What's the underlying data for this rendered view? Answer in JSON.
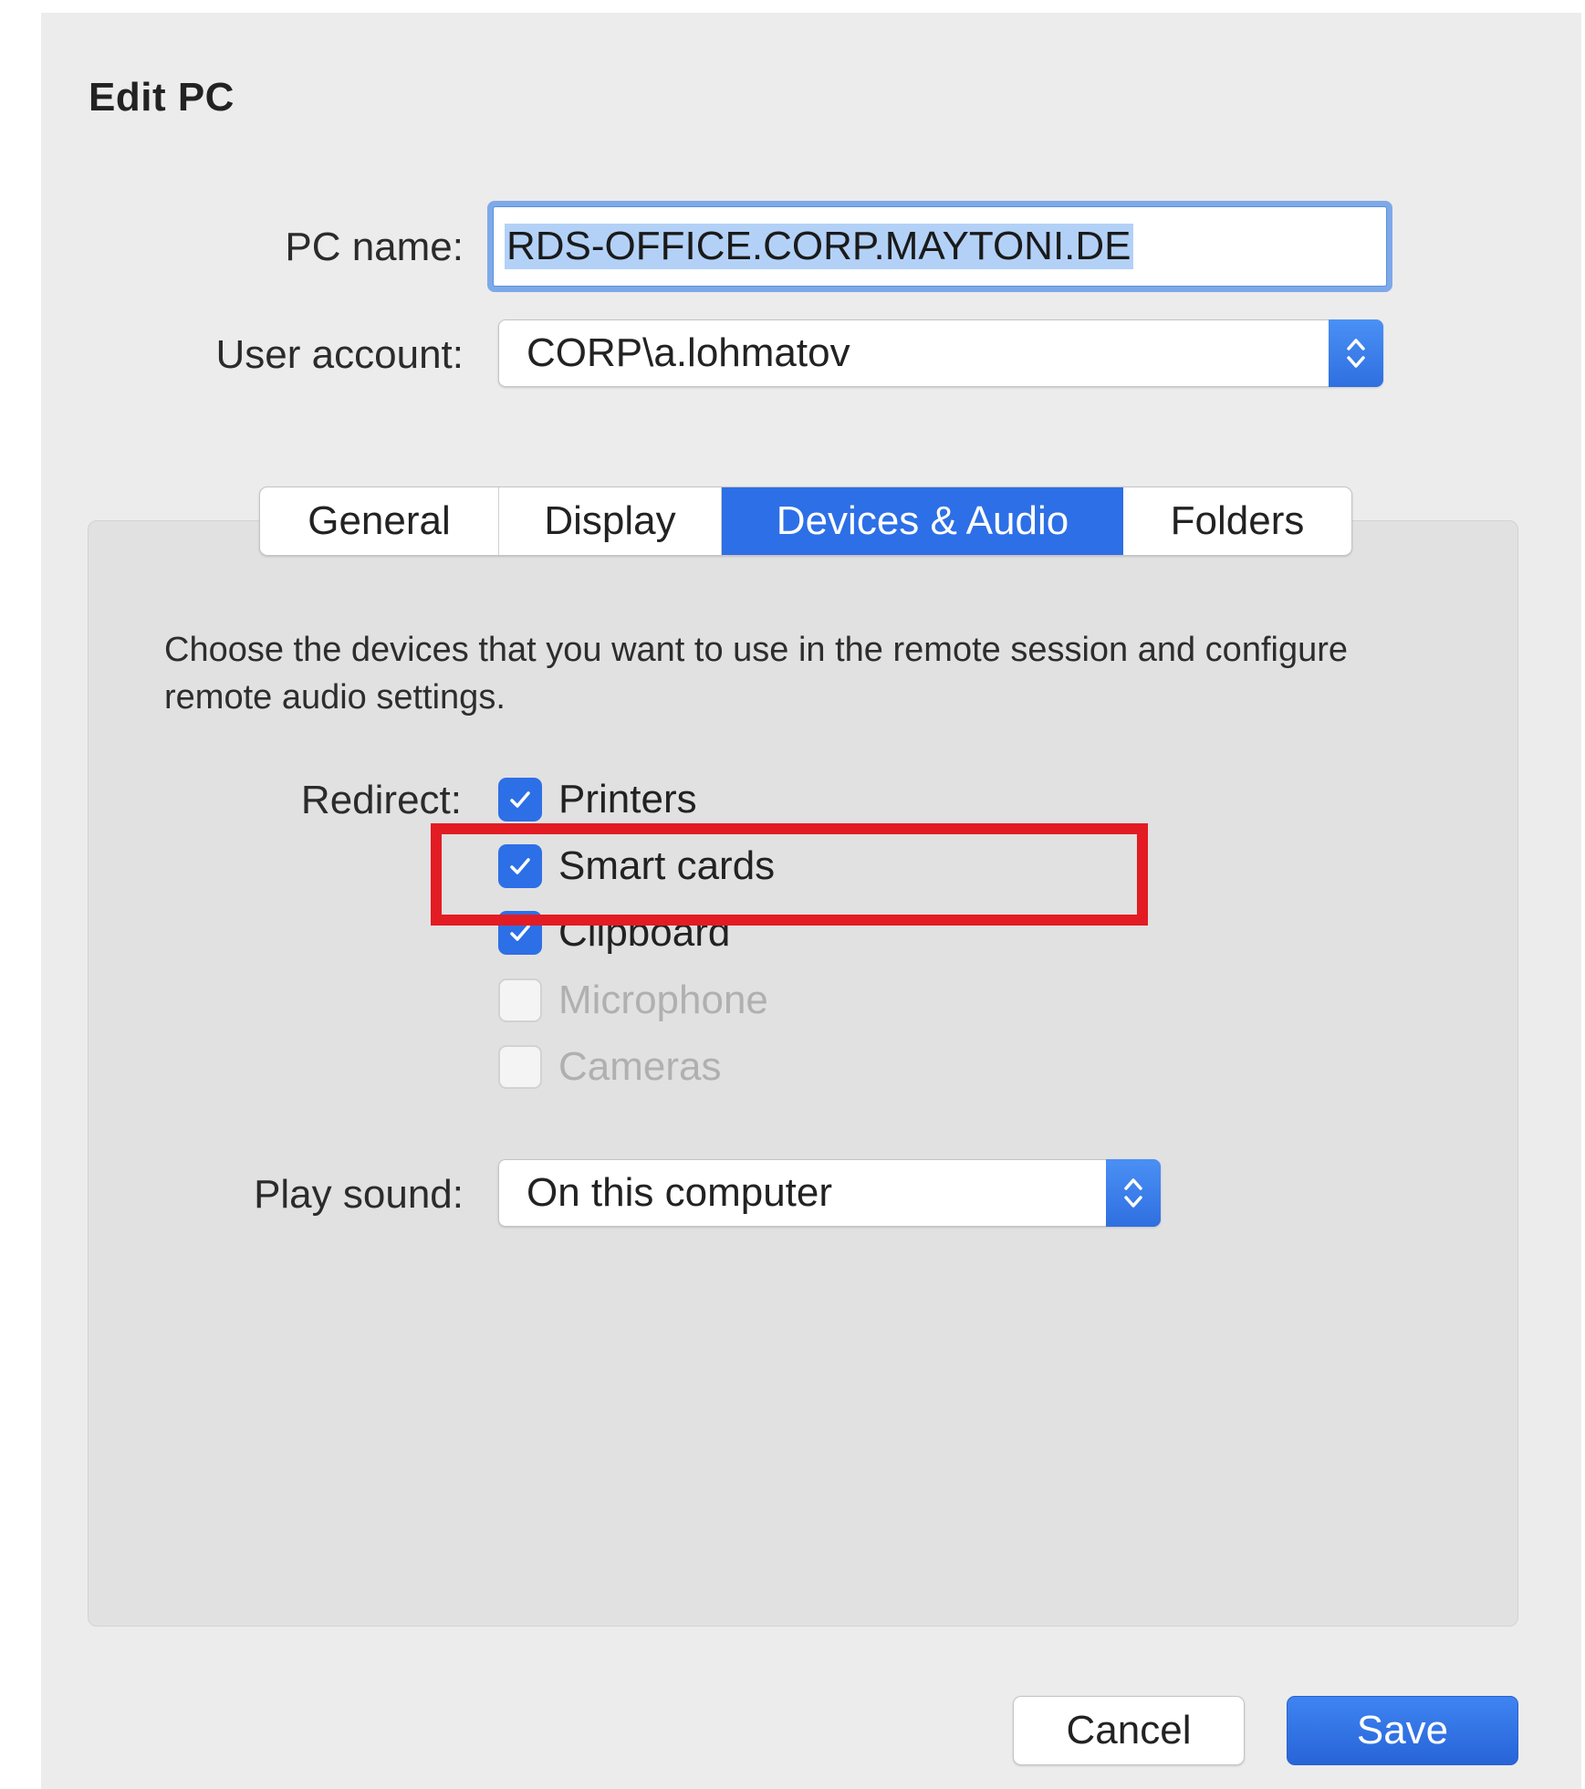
{
  "dialog": {
    "title": "Edit PC"
  },
  "pc_name": {
    "label": "PC name:",
    "value": "RDS-OFFICE.CORP.MAYTONI.DE"
  },
  "user_account": {
    "label": "User account:",
    "value": "CORP\\a.lohmatov"
  },
  "tabs": [
    {
      "label": "General",
      "active": false
    },
    {
      "label": "Display",
      "active": false
    },
    {
      "label": "Devices & Audio",
      "active": true
    },
    {
      "label": "Folders",
      "active": false
    }
  ],
  "devices": {
    "description": "Choose the devices that you want to use in the remote session and configure remote audio settings.",
    "redirect_label": "Redirect:",
    "options": [
      {
        "label": "Printers",
        "checked": true,
        "enabled": true
      },
      {
        "label": "Smart cards",
        "checked": true,
        "enabled": true
      },
      {
        "label": "Clipboard",
        "checked": true,
        "enabled": true
      },
      {
        "label": "Microphone",
        "checked": false,
        "enabled": false
      },
      {
        "label": "Cameras",
        "checked": false,
        "enabled": false
      }
    ],
    "play_sound": {
      "label": "Play sound:",
      "value": "On this computer"
    }
  },
  "buttons": {
    "cancel": "Cancel",
    "save": "Save"
  },
  "colors": {
    "accent": "#2d6fe6",
    "highlight": "#e31b23",
    "window_bg": "#ececec",
    "panel_bg": "#e1e1e1"
  },
  "icons": {
    "stepper": "chevron-up-down-icon",
    "check": "checkmark-icon"
  }
}
